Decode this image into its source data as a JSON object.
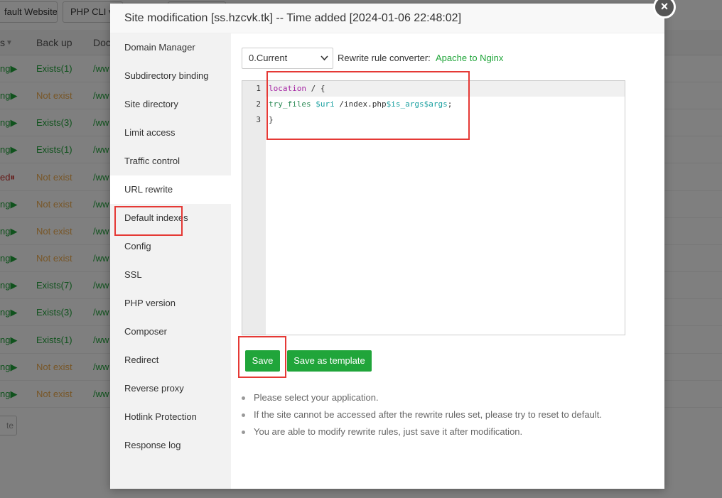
{
  "background": {
    "top_buttons": [
      "fault Website",
      "PHP CLI v"
    ],
    "columns": [
      "s",
      "Back up",
      "Doc"
    ],
    "rows": [
      {
        "status": "ng▶",
        "backup": "Exists(1)",
        "doc": "/ww"
      },
      {
        "status": "ng▶",
        "backup": "Not exist",
        "doc": "/ww"
      },
      {
        "status": "ng▶",
        "backup": "Exists(3)",
        "doc": "/ww"
      },
      {
        "status": "ng▶",
        "backup": "Exists(1)",
        "doc": "/ww"
      },
      {
        "status": "ed⏸",
        "backup": "Not exist",
        "doc": "/ww"
      },
      {
        "status": "ng▶",
        "backup": "Not exist",
        "doc": "/ww"
      },
      {
        "status": "ng▶",
        "backup": "Not exist",
        "doc": "/ww"
      },
      {
        "status": "ng▶",
        "backup": "Not exist",
        "doc": "/ww"
      },
      {
        "status": "ng▶",
        "backup": "Exists(7)",
        "doc": "/ww"
      },
      {
        "status": "ng▶",
        "backup": "Exists(3)",
        "doc": "/ww"
      },
      {
        "status": "ng▶",
        "backup": "Exists(1)",
        "doc": "/ww"
      },
      {
        "status": "ng▶",
        "backup": "Not exist",
        "doc": "/ww"
      },
      {
        "status": "ng▶",
        "backup": "Not exist",
        "doc": "/ww"
      }
    ],
    "bottom_button": "te"
  },
  "modal": {
    "title": "Site modification [ss.hzcvk.tk] -- Time added [2024-01-06 22:48:02]",
    "close_label": "×",
    "sidebar": {
      "items": [
        {
          "label": "Domain Manager"
        },
        {
          "label": "Subdirectory binding"
        },
        {
          "label": "Site directory"
        },
        {
          "label": "Limit access"
        },
        {
          "label": "Traffic control"
        },
        {
          "label": "URL rewrite",
          "active": true
        },
        {
          "label": "Default indexes"
        },
        {
          "label": "Config"
        },
        {
          "label": "SSL"
        },
        {
          "label": "PHP version"
        },
        {
          "label": "Composer"
        },
        {
          "label": "Redirect"
        },
        {
          "label": "Reverse proxy"
        },
        {
          "label": "Hotlink Protection"
        },
        {
          "label": "Response log"
        }
      ]
    },
    "rewrite": {
      "select_value": "0.Current",
      "converter_label": "Rewrite rule converter:",
      "converter_link": "Apache to Nginx",
      "code_lines": [
        {
          "num": "1",
          "parts": [
            {
              "t": "location",
              "c": "kw"
            },
            {
              "t": " / {",
              "c": ""
            }
          ]
        },
        {
          "num": "2",
          "parts": [
            {
              "t": "try_files",
              "c": "fn"
            },
            {
              "t": " ",
              "c": ""
            },
            {
              "t": "$uri",
              "c": "var"
            },
            {
              "t": " /index.php",
              "c": ""
            },
            {
              "t": "$is_args$args",
              "c": "var"
            },
            {
              "t": ";",
              "c": ""
            }
          ]
        },
        {
          "num": "3",
          "parts": [
            {
              "t": "}",
              "c": ""
            }
          ]
        }
      ],
      "save_label": "Save",
      "save_template_label": "Save as template",
      "tips": [
        "Please select your application.",
        "If the site cannot be accessed after the rewrite rules set, please try to reset to default.",
        "You are able to modify rewrite rules, just save it after modification."
      ]
    }
  },
  "colors": {
    "accent": "#20a53a",
    "highlight": "#e53935",
    "warning": "#f0ad4e",
    "danger": "#c9302c"
  }
}
